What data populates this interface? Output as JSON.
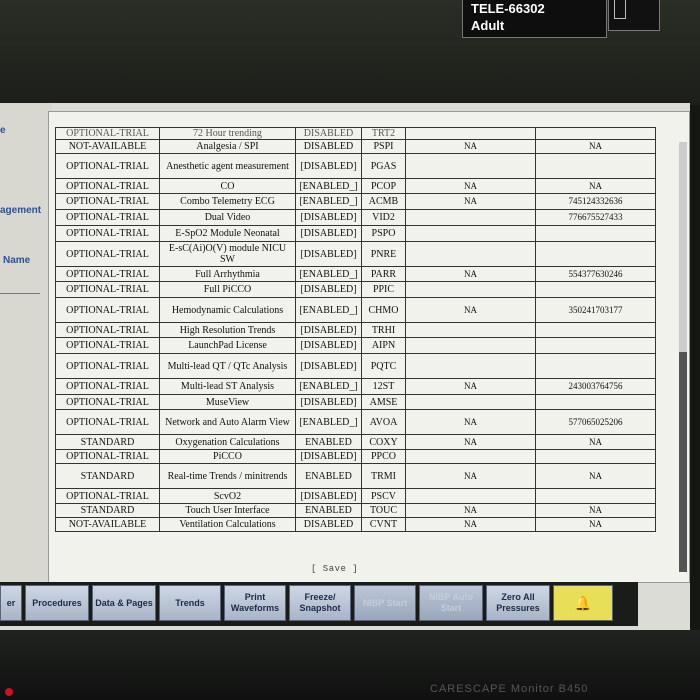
{
  "patient": {
    "id": "TELE-66302",
    "category": "Adult"
  },
  "side_labels": [
    "e",
    "agement",
    "Name"
  ],
  "table": {
    "cut_row": [
      "OPTIONAL-TRIAL",
      "72 Hour trending",
      "DISABLED",
      "TRT2"
    ],
    "rows": [
      [
        "NOT-AVAILABLE",
        "Analgesia / SPI",
        "DISABLED",
        "PSPI",
        "NA",
        "NA"
      ],
      [
        "OPTIONAL-TRIAL",
        "Anesthetic agent measurement",
        "[DISABLED]",
        "PGAS",
        "",
        ""
      ],
      [
        "OPTIONAL-TRIAL",
        "CO",
        "[ENABLED_]",
        "PCOP",
        "NA",
        "NA"
      ],
      [
        "OPTIONAL-TRIAL",
        "Combo Telemetry ECG",
        "[ENABLED_]",
        "ACMB",
        "NA",
        "745124332636"
      ],
      [
        "OPTIONAL-TRIAL",
        "Dual Video",
        "[DISABLED]",
        "VID2",
        "",
        "776675527433"
      ],
      [
        "OPTIONAL-TRIAL",
        "E-SpO2 Module Neonatal",
        "[DISABLED]",
        "PSPO",
        "",
        ""
      ],
      [
        "OPTIONAL-TRIAL",
        "E-sC(Ai)O(V) module NICU SW",
        "[DISABLED]",
        "PNRE",
        "",
        ""
      ],
      [
        "OPTIONAL-TRIAL",
        "Full Arrhythmia",
        "[ENABLED_]",
        "PARR",
        "NA",
        "554377630246"
      ],
      [
        "OPTIONAL-TRIAL",
        "Full PiCCO",
        "[DISABLED]",
        "PPIC",
        "",
        ""
      ],
      [
        "OPTIONAL-TRIAL",
        "Hemodynamic Calculations",
        "[ENABLED_]",
        "CHMO",
        "NA",
        "350241703177"
      ],
      [
        "OPTIONAL-TRIAL",
        "High Resolution Trends",
        "[DISABLED]",
        "TRHI",
        "",
        ""
      ],
      [
        "OPTIONAL-TRIAL",
        "LaunchPad License",
        "[DISABLED]",
        "AIPN",
        "",
        ""
      ],
      [
        "OPTIONAL-TRIAL",
        "Multi-lead QT / QTc Analysis",
        "[DISABLED]",
        "PQTC",
        "",
        ""
      ],
      [
        "OPTIONAL-TRIAL",
        "Multi-lead ST Analysis",
        "[ENABLED_]",
        "12ST",
        "NA",
        "243003764756"
      ],
      [
        "OPTIONAL-TRIAL",
        "MuseView",
        "[DISABLED]",
        "AMSE",
        "",
        ""
      ],
      [
        "OPTIONAL-TRIAL",
        "Network and Auto Alarm View",
        "[ENABLED_]",
        "AVOA",
        "NA",
        "577065025206"
      ],
      [
        "STANDARD",
        "Oxygenation Calculations",
        "ENABLED",
        "COXY",
        "NA",
        "NA"
      ],
      [
        "OPTIONAL-TRIAL",
        "PiCCO",
        "[DISABLED]",
        "PPCO",
        "",
        ""
      ],
      [
        "STANDARD",
        "Real-time Trends / minitrends",
        "ENABLED",
        "TRMI",
        "NA",
        "NA"
      ],
      [
        "OPTIONAL-TRIAL",
        "ScvO2",
        "[DISABLED]",
        "PSCV",
        "",
        ""
      ],
      [
        "STANDARD",
        "Touch User Interface",
        "ENABLED",
        "TOUC",
        "NA",
        "NA"
      ],
      [
        "NOT-AVAILABLE",
        "Ventilation Calculations",
        "DISABLED",
        "CVNT",
        "NA",
        "NA"
      ]
    ]
  },
  "save_label": "[ Save ]",
  "menu": [
    {
      "label": "er",
      "disabled": false
    },
    {
      "label": "Procedures",
      "disabled": false
    },
    {
      "label": "Data & Pages",
      "disabled": false
    },
    {
      "label": "Trends",
      "disabled": false
    },
    {
      "label": "Print Waveforms",
      "disabled": false
    },
    {
      "label": "Freeze/ Snapshot",
      "disabled": false
    },
    {
      "label": "NIBP Start",
      "disabled": true
    },
    {
      "label": "NIBP Auto Start",
      "disabled": true
    },
    {
      "label": "Zero All Pressures",
      "disabled": false
    }
  ],
  "model": "CARESCAPE Monitor B450",
  "colors": {
    "alarm_button": "#e8df59",
    "side_label": "#2a4fa5"
  }
}
